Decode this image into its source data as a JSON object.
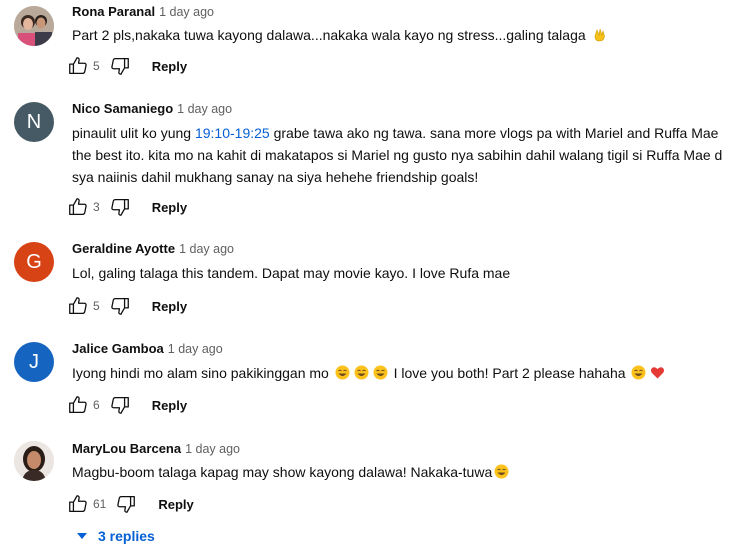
{
  "colors": {
    "link": "#065fd4",
    "meta_text": "#606060",
    "text": "#0f0f0f",
    "avatar_n": "#455a64",
    "avatar_g": "#d84315",
    "avatar_j": "#1565c0"
  },
  "comments": [
    {
      "author": "Rona Paranal",
      "time": "1 day ago",
      "avatar_type": "photo",
      "text_parts": [
        "Part 2 pls,nakaka tuwa kayong dalawa...nakaka wala kayo ng stress...galing talaga"
      ],
      "emoji": [
        "clapping-hand"
      ],
      "likes": "5",
      "reply_label": "Reply"
    },
    {
      "author": "Nico Samaniego",
      "time": "1 day ago",
      "avatar_letter": "N",
      "text_before": "pinaulit ulit ko yung ",
      "timestamp_link": "19:10-19:25",
      "text_after": " grabe tawa ako ng tawa. sana more vlogs pa with Mariel and Ruffa Mae the best ito. kita mo na kahit di makatapos si Mariel ng gusto nya sabihin dahil walang tigil si Ruffa Mae d sya naiinis dahil mukhang sanay na siya hehehe friendship goals!",
      "likes": "3",
      "reply_label": "Reply"
    },
    {
      "author": "Geraldine Ayotte",
      "time": "1 day ago",
      "avatar_letter": "G",
      "text": "Lol, galing talaga this tandem. Dapat may movie kayo. I love Rufa mae",
      "likes": "5",
      "reply_label": "Reply"
    },
    {
      "author": "Jalice Gamboa",
      "time": "1 day ago",
      "avatar_letter": "J",
      "text_1": "Iyong hindi mo alam sino pakikinggan mo",
      "text_2": " I love you both! Part 2 please hahaha",
      "emoji": [
        "laughing-face",
        "laughing-face",
        "laughing-face",
        "laughing-face",
        "red-heart"
      ],
      "likes": "6",
      "reply_label": "Reply"
    },
    {
      "author": "MaryLou Barcena",
      "time": "1 day ago",
      "avatar_type": "photo",
      "text": "Magbu-boom talaga kapag may show kayong dalawa! Nakaka-tuwa",
      "emoji": [
        "laughing-face"
      ],
      "likes": "61",
      "reply_label": "Reply"
    }
  ],
  "replies_toggle": {
    "label": "3 replies",
    "icon": "caret-down-icon"
  }
}
